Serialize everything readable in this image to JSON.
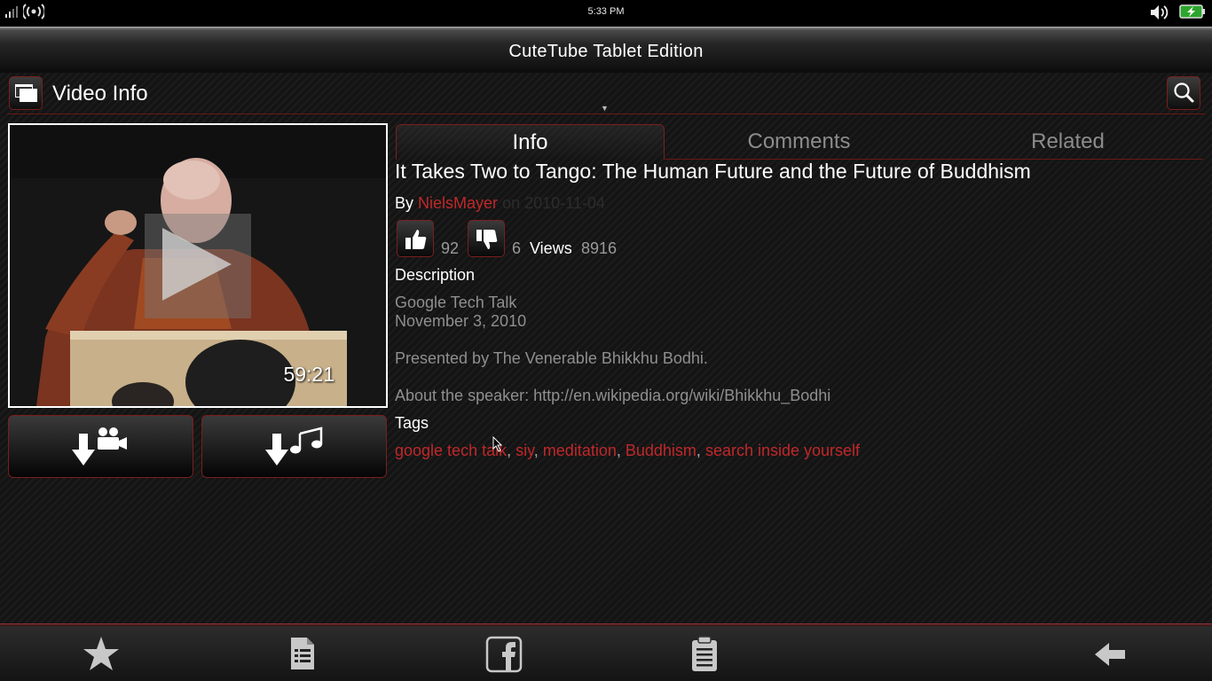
{
  "status_bar": {
    "time": "5:33 PM"
  },
  "app": {
    "title": "CuteTube Tablet Edition"
  },
  "header": {
    "page_title": "Video Info"
  },
  "video": {
    "duration": "59:21"
  },
  "tabs": [
    {
      "label": "Info",
      "active": true
    },
    {
      "label": "Comments",
      "active": false
    },
    {
      "label": "Related",
      "active": false
    }
  ],
  "info": {
    "title": "It Takes Two to Tango: The Human Future and the Future of Buddhism",
    "by_label": "By",
    "author": "NielsMayer",
    "date_text": "on 2010-11-04",
    "likes": "92",
    "dislikes": "6",
    "views_label": "Views",
    "views": "8916",
    "description_heading": "Description",
    "description_lines": [
      "Google Tech Talk",
      "November 3, 2010",
      "",
      "Presented by The Venerable Bhikkhu Bodhi.",
      "",
      "About the speaker: http://en.wikipedia.org/wiki/Bhikkhu_Bodhi"
    ],
    "tags_heading": "Tags",
    "tags": [
      "google tech talk",
      "siy",
      "meditation",
      "Buddhism",
      "search inside yourself"
    ]
  },
  "colors": {
    "accent": "#c0282a",
    "border": "#7a1e1e",
    "muted_text": "#8f8f8f"
  },
  "icons": [
    "signal-icon",
    "wifi-icon",
    "volume-icon",
    "battery-icon",
    "windows-icon",
    "search-icon",
    "play-icon",
    "download-video-icon",
    "download-audio-icon",
    "thumbs-up-icon",
    "thumbs-down-icon",
    "star-icon",
    "document-icon",
    "facebook-icon",
    "clipboard-icon",
    "back-arrow-icon"
  ]
}
